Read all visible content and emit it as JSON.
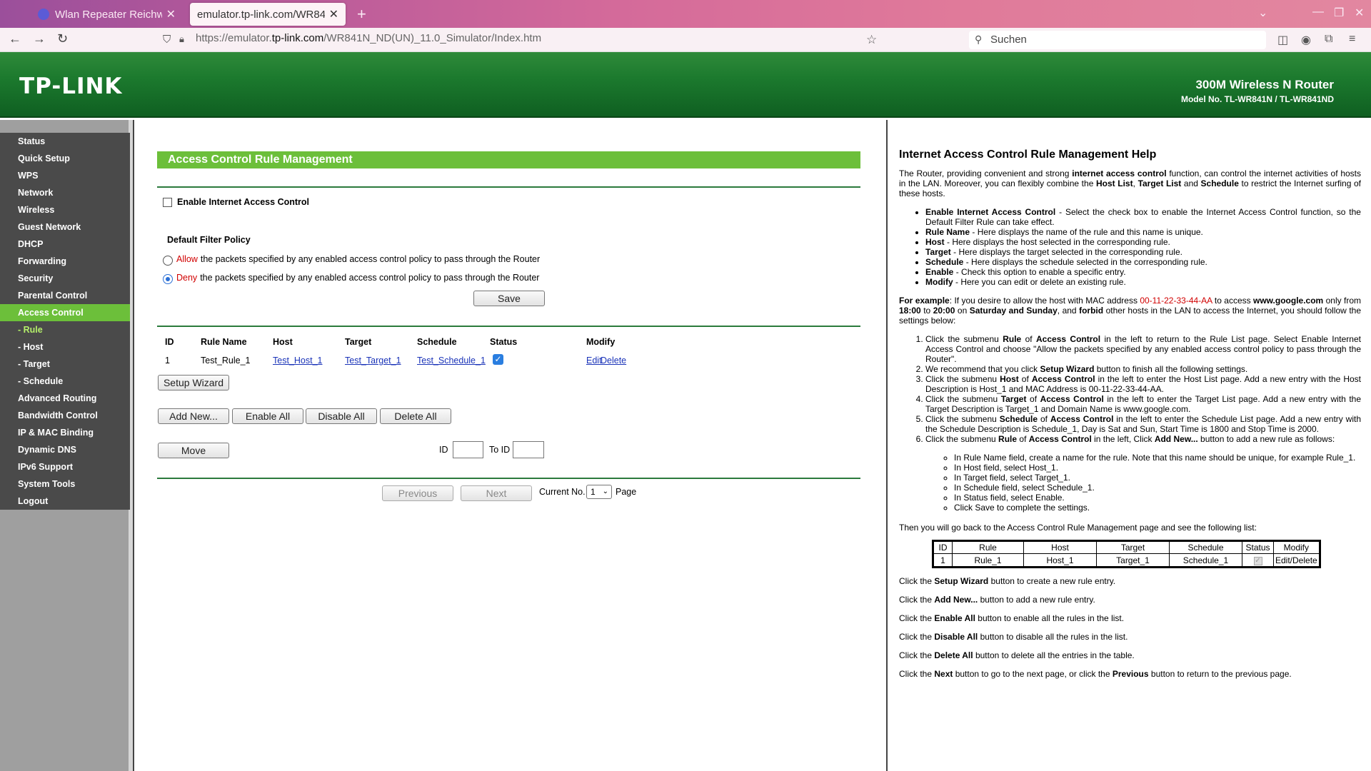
{
  "browser": {
    "tabs": [
      {
        "label": "Wlan Repeater Reichweite",
        "active": false
      },
      {
        "label": "emulator.tp-link.com/WR841N",
        "active": true
      }
    ],
    "url_prefix": "https://emulator.",
    "url_host": "tp-link.com",
    "url_path": "/WR841N_ND(UN)_11.0_Simulator/Index.htm",
    "search_placeholder": "Suchen"
  },
  "header": {
    "logo": "TP-LINK",
    "product": "300M Wireless N Router",
    "model": "Model No. TL-WR841N / TL-WR841ND"
  },
  "menu": [
    {
      "label": "Status"
    },
    {
      "label": "Quick Setup"
    },
    {
      "label": "WPS"
    },
    {
      "label": "Network"
    },
    {
      "label": "Wireless"
    },
    {
      "label": "Guest Network"
    },
    {
      "label": "DHCP"
    },
    {
      "label": "Forwarding"
    },
    {
      "label": "Security"
    },
    {
      "label": "Parental Control"
    },
    {
      "label": "Access Control"
    },
    {
      "label": "- Rule"
    },
    {
      "label": "- Host"
    },
    {
      "label": "- Target"
    },
    {
      "label": "- Schedule"
    },
    {
      "label": "Advanced Routing"
    },
    {
      "label": "Bandwidth Control"
    },
    {
      "label": "IP & MAC Binding"
    },
    {
      "label": "Dynamic DNS"
    },
    {
      "label": "IPv6 Support"
    },
    {
      "label": "System Tools"
    },
    {
      "label": "Logout"
    }
  ],
  "main": {
    "title": "Access Control Rule Management",
    "enable_label": "Enable Internet Access Control",
    "enable_checked": false,
    "policy_title": "Default Filter Policy",
    "allow_word": "Allow",
    "allow_text": "the packets specified by any enabled access control policy to pass through the Router",
    "deny_word": "Deny",
    "deny_text": "the packets specified by any enabled access control policy to pass through the Router",
    "selected_policy": "deny",
    "save_label": "Save",
    "table_headers": {
      "id": "ID",
      "rule": "Rule Name",
      "host": "Host",
      "target": "Target",
      "schedule": "Schedule",
      "status": "Status",
      "modify": "Modify"
    },
    "rows": [
      {
        "id": "1",
        "rule": "Test_Rule_1",
        "host": "Test_Host_1",
        "target": "Test_Target_1",
        "schedule": "Test_Schedule_1",
        "status": true,
        "edit": "Edit",
        "delete": "Delete"
      }
    ],
    "setup_wizard_label": "Setup Wizard",
    "add_new_label": "Add New...",
    "enable_all_label": "Enable All",
    "disable_all_label": "Disable All",
    "delete_all_label": "Delete All",
    "move_label": "Move",
    "id_label": "ID",
    "to_id_label": "To ID",
    "previous_label": "Previous",
    "next_label": "Next",
    "current_no_label": "Current No.",
    "page_value": "1",
    "page_label": "Page"
  },
  "help": {
    "title": "Internet Access Control Rule Management Help"
  }
}
